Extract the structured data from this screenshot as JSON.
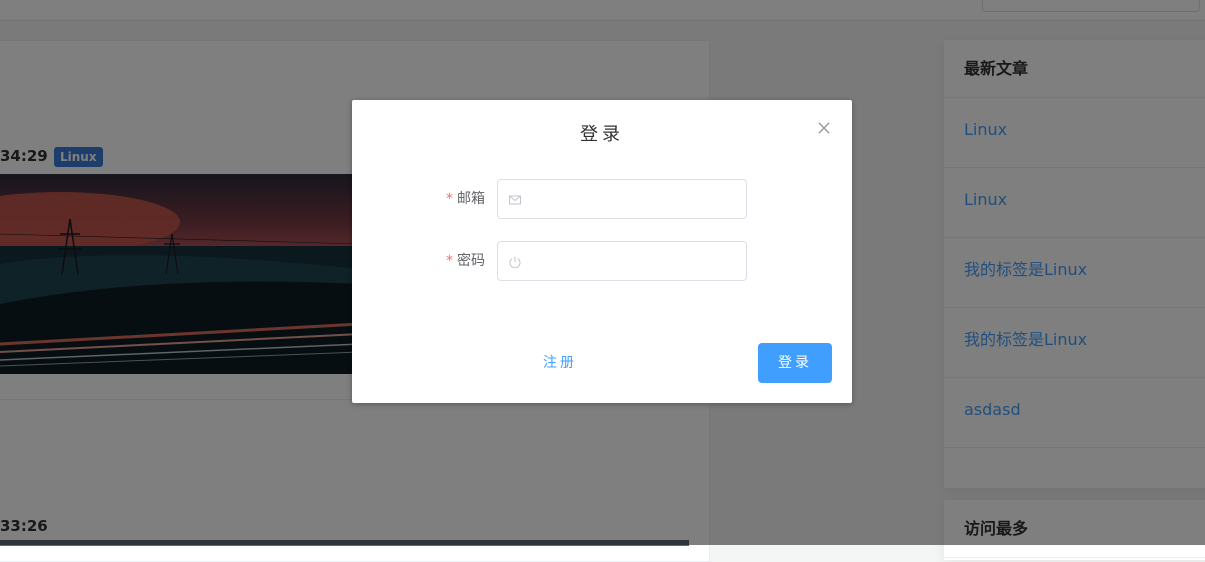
{
  "posts": [
    {
      "time": "34:29",
      "tag": "Linux"
    },
    {
      "time": "33:26"
    }
  ],
  "sidebar": {
    "latest": {
      "title": "最新文章",
      "items": [
        "Linux",
        "Linux",
        "我的标签是Linux",
        "我的标签是Linux",
        "asdasd"
      ]
    },
    "most_visited": {
      "title": "访问最多"
    }
  },
  "dialog": {
    "title": "登录",
    "email": {
      "label": "邮箱",
      "required_mark": "*",
      "value": "",
      "icon": "mail-icon"
    },
    "password": {
      "label": "密码",
      "required_mark": "*",
      "value": "",
      "icon": "power-icon"
    },
    "register_label": "注册",
    "login_label": "登录"
  },
  "colors": {
    "primary": "#409eff",
    "required": "#f56c6c",
    "tag": "#3a7bd5"
  }
}
